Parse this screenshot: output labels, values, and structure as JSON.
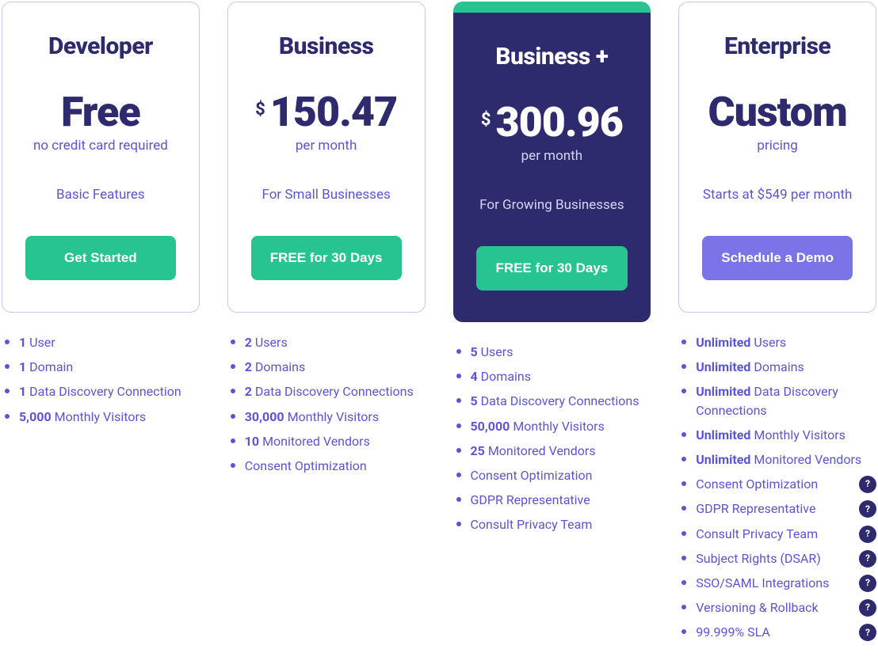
{
  "plans": [
    {
      "name": "Developer",
      "priceMain": "Free",
      "priceSub": "no credit card required",
      "desc": "Basic Features",
      "cta": "Get Started",
      "ctaStyle": "green",
      "featured": false,
      "currency": "",
      "features": [
        {
          "strong": "1",
          "label": "User"
        },
        {
          "strong": "1",
          "label": "Domain"
        },
        {
          "strong": "1",
          "label": "Data Discovery Connection"
        },
        {
          "strong": "5,000",
          "label": "Monthly Visitors"
        }
      ]
    },
    {
      "name": "Business",
      "currency": "$",
      "priceMain": "150.47",
      "priceSub": "per month",
      "desc": "For Small Businesses",
      "cta": "FREE for 30 Days",
      "ctaStyle": "green",
      "featured": false,
      "features": [
        {
          "strong": "2",
          "label": "Users"
        },
        {
          "strong": "2",
          "label": "Domains"
        },
        {
          "strong": "2",
          "label": "Data Discovery Connections"
        },
        {
          "strong": "30,000",
          "label": "Monthly Visitors"
        },
        {
          "strong": "10",
          "label": "Monitored Vendors"
        },
        {
          "strong": "",
          "label": "Consent Optimization"
        }
      ]
    },
    {
      "name": "Business +",
      "currency": "$",
      "priceMain": "300.96",
      "priceSub": "per month",
      "desc": "For Growing Businesses",
      "cta": "FREE for 30 Days",
      "ctaStyle": "green",
      "featured": true,
      "features": [
        {
          "strong": "5",
          "label": "Users"
        },
        {
          "strong": "4",
          "label": "Domains"
        },
        {
          "strong": "5",
          "label": "Data Discovery Connections"
        },
        {
          "strong": "50,000",
          "label": "Monthly Visitors"
        },
        {
          "strong": "25",
          "label": "Monitored Vendors"
        },
        {
          "strong": "",
          "label": "Consent Optimization"
        },
        {
          "strong": "",
          "label": "GDPR Representative"
        },
        {
          "strong": "",
          "label": "Consult Privacy Team"
        }
      ]
    },
    {
      "name": "Enterprise",
      "currency": "",
      "priceMain": "Custom",
      "priceSub": "pricing",
      "desc": "Starts at $549 per month",
      "cta": "Schedule a Demo",
      "ctaStyle": "purple",
      "featured": false,
      "features": [
        {
          "strong": "Unlimited",
          "label": "Users"
        },
        {
          "strong": "Unlimited",
          "label": "Domains"
        },
        {
          "strong": "Unlimited",
          "label": "Data Discovery Connections"
        },
        {
          "strong": "Unlimited",
          "label": "Monthly Visitors"
        },
        {
          "strong": "Unlimited",
          "label": "Monitored Vendors"
        },
        {
          "strong": "",
          "label": "Consent Optimization",
          "help": true
        },
        {
          "strong": "",
          "label": "GDPR Representative",
          "help": true
        },
        {
          "strong": "",
          "label": "Consult Privacy Team",
          "help": true
        },
        {
          "strong": "",
          "label": "Subject Rights (DSAR)",
          "help": true
        },
        {
          "strong": "",
          "label": "SSO/SAML Integrations",
          "help": true
        },
        {
          "strong": "",
          "label": "Versioning & Rollback",
          "help": true
        },
        {
          "strong": "",
          "label": "99.999% SLA",
          "help": true
        }
      ]
    }
  ],
  "helpGlyph": "?"
}
